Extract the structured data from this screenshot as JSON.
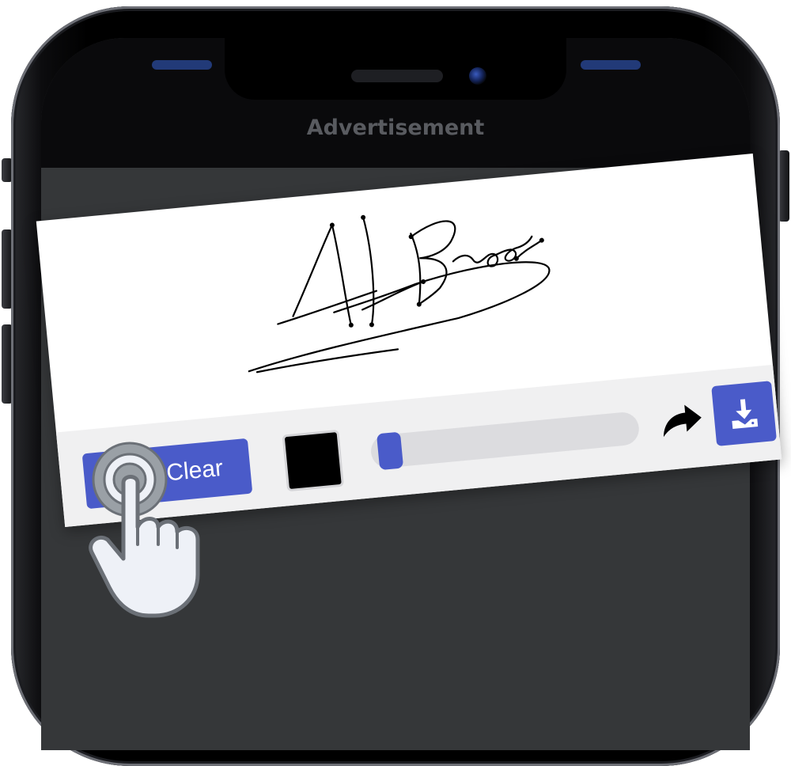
{
  "screen": {
    "ad_label": "Advertisement"
  },
  "signature": {
    "text": "A.F. Brook"
  },
  "toolbar": {
    "clear_label": "Clear",
    "pen_color": "#000000",
    "stroke_width_fraction": 0.03
  },
  "colors": {
    "accent": "#4a5bc9",
    "screen_background": "#353739",
    "toolbar_background": "#f0f0f1"
  },
  "icons": {
    "clear": "eraser-icon",
    "redo": "redo-arrow-icon",
    "download": "download-icon",
    "gesture": "tap-hand-icon"
  }
}
